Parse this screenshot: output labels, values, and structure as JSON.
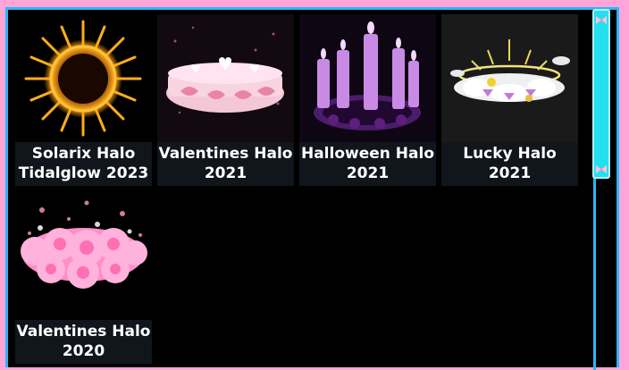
{
  "inventory": {
    "items": [
      {
        "line1": "Solarix Halo",
        "line2": "Tidalglow 2023",
        "icon": "solarix-halo-image"
      },
      {
        "line1": "Valentines Halo",
        "line2": "2021",
        "icon": "valentines-halo-2021-image"
      },
      {
        "line1": "Halloween Halo",
        "line2": "2021",
        "icon": "halloween-halo-image"
      },
      {
        "line1": "Lucky Halo",
        "line2": "2021",
        "icon": "lucky-halo-image"
      },
      {
        "line1": "Valentines Halo",
        "line2": "2020",
        "icon": "valentines-halo-2020-image"
      }
    ]
  },
  "colors": {
    "background": "#ffa5d8",
    "border": "#2ab7f5",
    "panel": "#000000",
    "label_bg": "#11151c",
    "scrollbar": "#24dff0"
  }
}
